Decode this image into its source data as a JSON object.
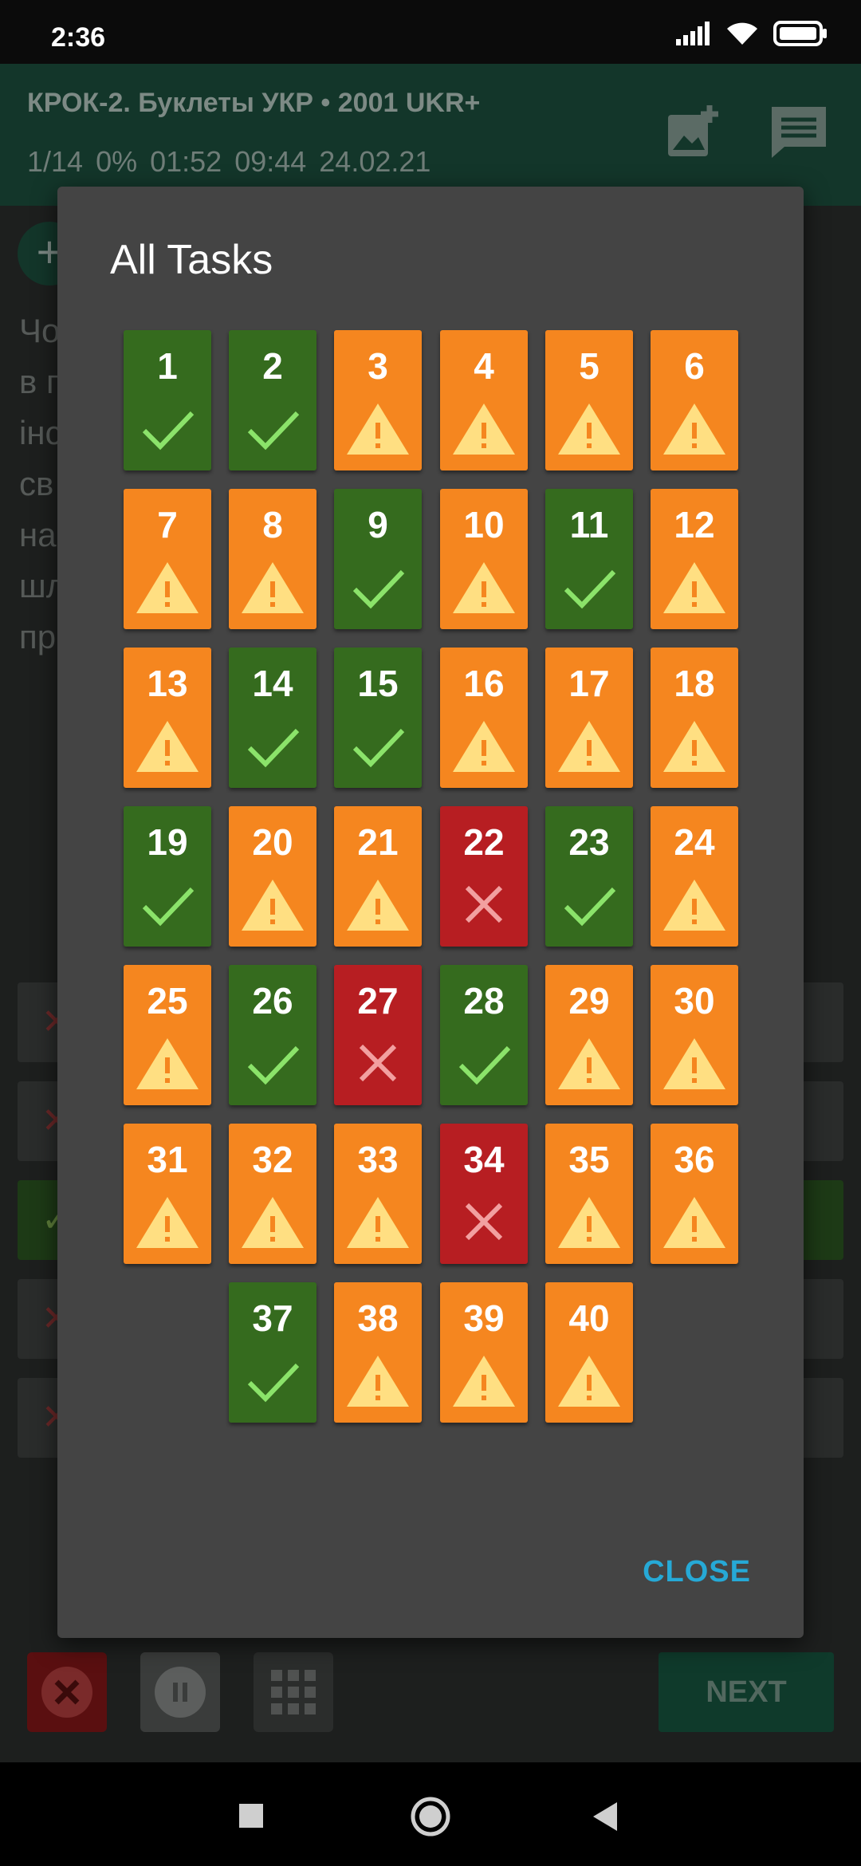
{
  "status_bar": {
    "time": "2:36"
  },
  "header": {
    "title": "КРОК-2. Буклеты УКР • 2001 UKR+",
    "stats": "1/14  0%  01:52  09:44  24.02.21"
  },
  "background": {
    "text_lines": [
      "Чо",
      "в п",
      "інс",
      "св",
      "на",
      "шл",
      "пр"
    ]
  },
  "toolbar": {
    "next_label": "NEXT"
  },
  "dialog": {
    "title": "All Tasks",
    "close_label": "CLOSE",
    "tasks": [
      {
        "num": "1",
        "status": "correct"
      },
      {
        "num": "2",
        "status": "correct"
      },
      {
        "num": "3",
        "status": "warning"
      },
      {
        "num": "4",
        "status": "warning"
      },
      {
        "num": "5",
        "status": "warning"
      },
      {
        "num": "6",
        "status": "warning"
      },
      {
        "num": "7",
        "status": "warning"
      },
      {
        "num": "8",
        "status": "warning"
      },
      {
        "num": "9",
        "status": "correct"
      },
      {
        "num": "10",
        "status": "warning"
      },
      {
        "num": "11",
        "status": "correct"
      },
      {
        "num": "12",
        "status": "warning"
      },
      {
        "num": "13",
        "status": "warning"
      },
      {
        "num": "14",
        "status": "correct"
      },
      {
        "num": "15",
        "status": "correct"
      },
      {
        "num": "16",
        "status": "warning"
      },
      {
        "num": "17",
        "status": "warning"
      },
      {
        "num": "18",
        "status": "warning"
      },
      {
        "num": "19",
        "status": "correct"
      },
      {
        "num": "20",
        "status": "warning"
      },
      {
        "num": "21",
        "status": "warning"
      },
      {
        "num": "22",
        "status": "wrong"
      },
      {
        "num": "23",
        "status": "correct"
      },
      {
        "num": "24",
        "status": "warning"
      },
      {
        "num": "25",
        "status": "warning"
      },
      {
        "num": "26",
        "status": "correct"
      },
      {
        "num": "27",
        "status": "wrong"
      },
      {
        "num": "28",
        "status": "correct"
      },
      {
        "num": "29",
        "status": "warning"
      },
      {
        "num": "30",
        "status": "warning"
      },
      {
        "num": "31",
        "status": "warning"
      },
      {
        "num": "32",
        "status": "warning"
      },
      {
        "num": "33",
        "status": "warning"
      },
      {
        "num": "34",
        "status": "wrong"
      },
      {
        "num": "35",
        "status": "warning"
      },
      {
        "num": "36",
        "status": "warning"
      },
      {
        "num": "37",
        "status": "correct"
      },
      {
        "num": "38",
        "status": "warning"
      },
      {
        "num": "39",
        "status": "warning"
      },
      {
        "num": "40",
        "status": "warning"
      }
    ]
  },
  "colors": {
    "correct": "#356b1e",
    "warning": "#f5861f",
    "wrong": "#b71e22",
    "accent": "#26a9d6"
  }
}
